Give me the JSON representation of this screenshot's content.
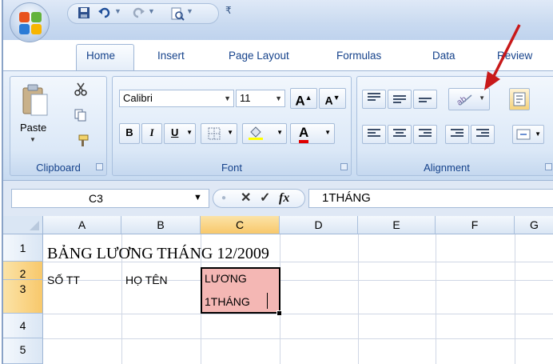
{
  "ribbon_tabs": [
    "Home",
    "Insert",
    "Page Layout",
    "Formulas",
    "Data",
    "Review"
  ],
  "clipboard": {
    "paste_label": "Paste",
    "group_label": "Clipboard"
  },
  "font": {
    "name": "Calibri",
    "size": "11",
    "group_label": "Font",
    "bold": "B",
    "italic": "I",
    "underline": "U",
    "grow": "A",
    "shrink": "A",
    "color": "A"
  },
  "alignment": {
    "group_label": "Alignment"
  },
  "formula_bar": {
    "cell_ref": "C3",
    "fx": "fx",
    "content": "1THÁNG"
  },
  "columns": [
    "A",
    "B",
    "C",
    "D",
    "E",
    "F",
    "G"
  ],
  "rows": [
    "1",
    "2",
    "3",
    "4",
    "5"
  ],
  "cells": {
    "A1": "BẢNG LƯƠNG THÁNG 12/2009",
    "A2": "SỐ TT",
    "B2": "HỌ TÊN",
    "C2_line1": "LƯƠNG",
    "C2_line2": "1THÁNG"
  },
  "colors": {
    "selected_cell_fill": "#f4b7b4",
    "selected_header": "#f8c86b",
    "arrow": "#c8191a"
  }
}
